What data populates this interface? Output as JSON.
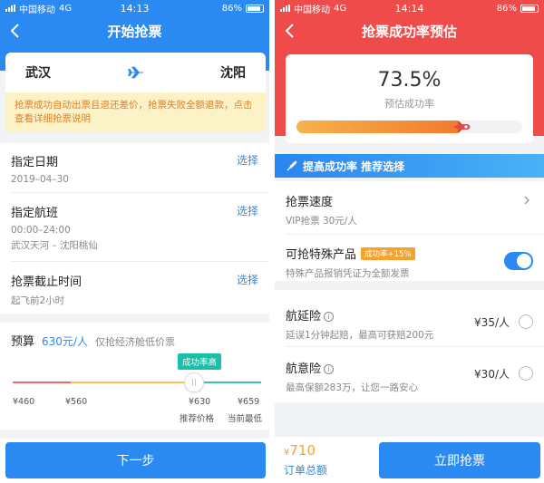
{
  "left": {
    "status": {
      "carrier": "中国移动",
      "network": "4G",
      "time": "14:13",
      "battery": "86%"
    },
    "nav_title": "开始抢票",
    "route": {
      "from": "武汉",
      "to": "沈阳"
    },
    "notice": "抢票成功自动出票且退还差价，抢票失败全额退款，点击查看详细抢票说明",
    "date": {
      "title": "指定日期",
      "value": "2019–04–30",
      "action": "选择"
    },
    "flight": {
      "title": "指定航班",
      "time": "00:00–24:00",
      "airports": "武汉天河 – 沈阳桃仙",
      "action": "选择"
    },
    "deadline": {
      "title": "抢票截止时间",
      "value": "起飞前2小时",
      "action": "选择"
    },
    "budget": {
      "label": "预算",
      "value": "630元/人",
      "note": "仅抢经济舱低价票",
      "badge": "成功率高",
      "ticks": [
        "¥460",
        "¥560",
        "¥630",
        "¥659"
      ],
      "tick_labels": [
        "推荐价格",
        "当前最低"
      ],
      "level_percent": 73
    },
    "next_button": "下一步",
    "colors": {
      "primary": "#2b8af1",
      "notice_bg": "#fcf2c7",
      "notice_text": "#e0802c"
    }
  },
  "right": {
    "status": {
      "carrier": "中国移动",
      "network": "4G",
      "time": "14:14",
      "battery": "86%"
    },
    "nav_title": "抢票成功率预估",
    "rate": {
      "value": "73.5%",
      "label": "预估成功率",
      "fill_percent": 73.5
    },
    "tip": "提高成功率 推荐选择",
    "speed": {
      "title": "抢票速度",
      "sub": "VIP抢票  30元/人"
    },
    "special": {
      "title": "可抢特殊产品",
      "badge": "成功率+15%",
      "sub": "特殊产品报销凭证为全额发票",
      "enabled": true
    },
    "delay_insurance": {
      "title": "航延险",
      "info": "i",
      "sub": "延误1分钟起赔，最高可获赔200元",
      "price": "¥35/人"
    },
    "accident_insurance": {
      "title": "航意险",
      "info": "i",
      "sub": "最高保额283万，让您一路安心",
      "price": "¥30/人"
    },
    "total": {
      "currency": "¥",
      "amount": "710",
      "label": "订单总额"
    },
    "grab_button": "立即抢票",
    "colors": {
      "header": "#f04b4b",
      "primary": "#2b8af1",
      "accent": "#f7a12f"
    }
  }
}
